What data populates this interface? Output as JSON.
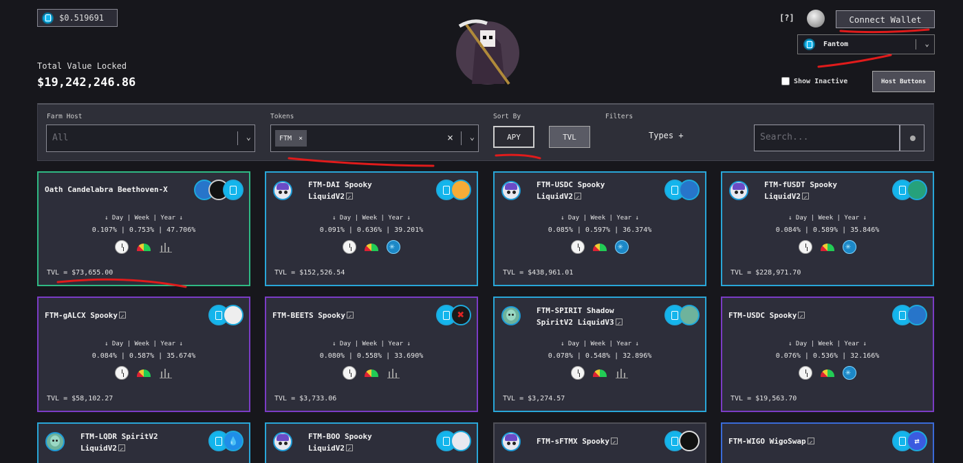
{
  "price": {
    "value": "$0.519691",
    "icon": "ftm-icon"
  },
  "tvl": {
    "label": "Total Value Locked",
    "value": "$19,242,246.86"
  },
  "header": {
    "help": "[?]",
    "connect_label": "Connect Wallet",
    "network": "Fantom",
    "show_inactive": "Show Inactive",
    "host_buttons": "Host Buttons"
  },
  "filters": {
    "farm_host_label": "Farm Host",
    "farm_host_placeholder": "All",
    "tokens_label": "Tokens",
    "token_chip": "FTM",
    "token_chip_remove": "×",
    "clear": "×",
    "sort_label": "Sort By",
    "sort_apy": "APY",
    "sort_tvl": "TVL",
    "filters_label": "Filters",
    "types": "Types +",
    "search_placeholder": "Search..."
  },
  "card_common": {
    "apy_header": "↓ Day | Week | Year ↓"
  },
  "cards": [
    {
      "title": "Oath Candelabra Beethoven-X",
      "apy": "0.107% | 0.753% | 47.706%",
      "tvl": "TVL = $73,655.00"
    },
    {
      "title": "FTM-DAI Spooky",
      "title2": "LiquidV2",
      "apy": "0.091% | 0.636% | 39.201%",
      "tvl": "TVL = $152,526.54"
    },
    {
      "title": "FTM-USDC Spooky",
      "title2": "LiquidV2",
      "apy": "0.085% | 0.597% | 36.374%",
      "tvl": "TVL = $438,961.01"
    },
    {
      "title": "FTM-fUSDT Spooky",
      "title2": "LiquidV2",
      "apy": "0.084% | 0.589% | 35.846%",
      "tvl": "TVL = $228,971.70"
    },
    {
      "title": "FTM-gALCX Spooky",
      "apy": "0.084% | 0.587% | 35.674%",
      "tvl": "TVL = $58,102.27"
    },
    {
      "title": "FTM-BEETS Spooky",
      "apy": "0.080% | 0.558% | 33.690%",
      "tvl": "TVL = $3,733.06"
    },
    {
      "title": "FTM-SPIRIT Shadow",
      "title2": "SpiritV2 LiquidV3",
      "apy": "0.078% | 0.548% | 32.896%",
      "tvl": "TVL = $3,274.57"
    },
    {
      "title": "FTM-USDC Spooky",
      "apy": "0.076% | 0.536% | 32.166%",
      "tvl": "TVL = $19,563.70"
    },
    {
      "title": "FTM-LQDR SpiritV2",
      "title2": "LiquidV2"
    },
    {
      "title": "FTM-BOO Spooky",
      "title2": "LiquidV2"
    },
    {
      "title": "FTM-sFTMX Spooky"
    },
    {
      "title": "FTM-WIGO WigoSwap"
    }
  ],
  "icons": [
    "ftm-icon",
    "moon-icon",
    "chevron-down-icon",
    "search-icon",
    "clock-icon",
    "gauge-icon",
    "bar-chart-icon",
    "snowflake-icon",
    "external-link-icon"
  ],
  "colors": {
    "background": "#17171c",
    "card": "#2d2e3a",
    "green_border": "#2fba84",
    "cyan_border": "#29a7d9",
    "purple_border": "#7b3cc6",
    "annotation_red": "#e01b1b"
  }
}
